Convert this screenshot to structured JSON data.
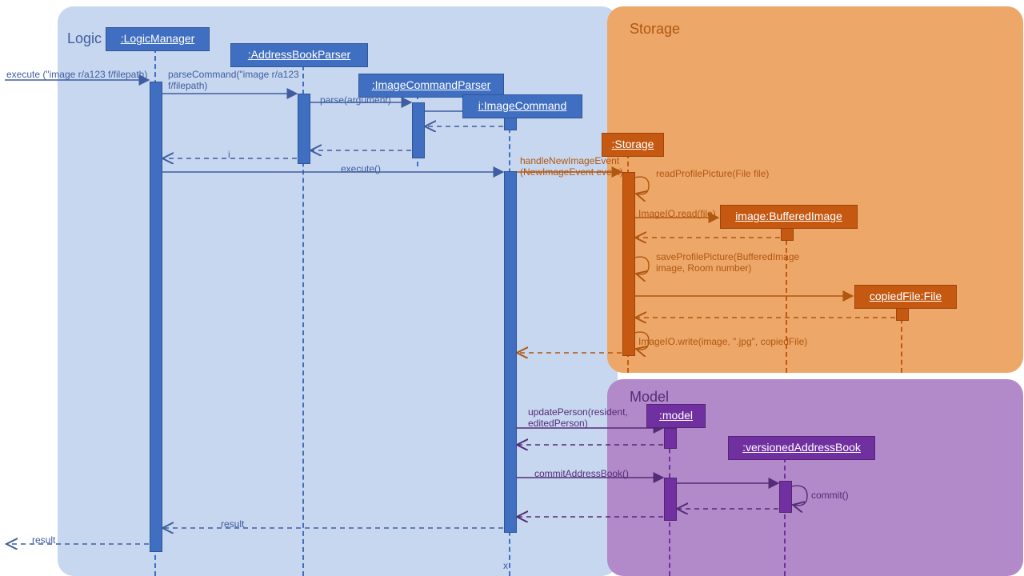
{
  "packages": {
    "logic": {
      "title": "Logic"
    },
    "storage": {
      "title": "Storage"
    },
    "model": {
      "title": "Model"
    }
  },
  "participants": {
    "logicManager": ":LogicManager",
    "parser": ":AddressBookParser",
    "icp": ":ImageCommandParser",
    "icmd": "i:ImageCommand",
    "storageObj": ":Storage",
    "buffered": "image:BufferedImage",
    "copied": "copiedFile:File",
    "modelObj": ":model",
    "vab": ":versionedAddressBook"
  },
  "messages": {
    "entry": "execute (\"image r/a123 f/filepath)",
    "parseCmd": "parseCommand(\"image r/a123 f/filepath)",
    "parseArg": "parse(argument)",
    "i": "i",
    "execute": "execute()",
    "handle": "handleNewImageEvent (NewImageEvent event)",
    "readProfile": "readProfilePicture(File file)",
    "ioRead": "ImageIO.read(file)",
    "saveProfile": "saveProfilePicture(BufferedImage image, Room number)",
    "ioWrite": "ImageIO.write(image, \".jpg\", copiedFile)",
    "updatePerson": "updatePerson(resident, editedPerson)",
    "commitAB": "commitAddressBook()",
    "commit": "commit()",
    "result": "result",
    "x": "x"
  },
  "colors": {
    "blue": "#406fc1",
    "orange": "#c55911",
    "purple": "#7030a0",
    "blueText": "#3f5da0",
    "orangeText": "#b15710",
    "purpleText": "#552b78"
  },
  "chart_data": {
    "type": "sequence-diagram",
    "packages": [
      "Logic",
      "Storage",
      "Model"
    ],
    "lifelines": [
      {
        "name": ":LogicManager",
        "package": "Logic"
      },
      {
        "name": ":AddressBookParser",
        "package": "Logic"
      },
      {
        "name": ":ImageCommandParser",
        "package": "Logic"
      },
      {
        "name": "i:ImageCommand",
        "package": "Logic"
      },
      {
        "name": ":Storage",
        "package": "Storage"
      },
      {
        "name": "image:BufferedImage",
        "package": "Storage"
      },
      {
        "name": "copiedFile:File",
        "package": "Storage"
      },
      {
        "name": ":model",
        "package": "Model"
      },
      {
        "name": ":versionedAddressBook",
        "package": "Model"
      }
    ],
    "messages": [
      {
        "from": "actor",
        "to": ":LogicManager",
        "label": "execute (\"image r/a123 f/filepath)",
        "kind": "call"
      },
      {
        "from": ":LogicManager",
        "to": ":AddressBookParser",
        "label": "parseCommand(\"image r/a123 f/filepath)",
        "kind": "call"
      },
      {
        "from": ":AddressBookParser",
        "to": ":ImageCommandParser",
        "label": "parse(argument)",
        "kind": "call"
      },
      {
        "from": ":ImageCommandParser",
        "to": "i:ImageCommand",
        "label": "",
        "kind": "create"
      },
      {
        "from": "i:ImageCommand",
        "to": ":ImageCommandParser",
        "label": "",
        "kind": "return"
      },
      {
        "from": ":ImageCommandParser",
        "to": ":AddressBookParser",
        "label": "",
        "kind": "return"
      },
      {
        "from": ":AddressBookParser",
        "to": ":LogicManager",
        "label": "i",
        "kind": "return"
      },
      {
        "from": ":LogicManager",
        "to": "i:ImageCommand",
        "label": "execute()",
        "kind": "call"
      },
      {
        "from": "i:ImageCommand",
        "to": ":Storage",
        "label": "handleNewImageEvent (NewImageEvent event)",
        "kind": "call"
      },
      {
        "from": ":Storage",
        "to": ":Storage",
        "label": "readProfilePicture(File file)",
        "kind": "self"
      },
      {
        "from": ":Storage",
        "to": "image:BufferedImage",
        "label": "ImageIO.read(file)",
        "kind": "create"
      },
      {
        "from": "image:BufferedImage",
        "to": ":Storage",
        "label": "",
        "kind": "return"
      },
      {
        "from": ":Storage",
        "to": ":Storage",
        "label": "saveProfilePicture(BufferedImage image, Room number)",
        "kind": "self"
      },
      {
        "from": ":Storage",
        "to": "copiedFile:File",
        "label": "",
        "kind": "create"
      },
      {
        "from": "copiedFile:File",
        "to": ":Storage",
        "label": "",
        "kind": "return"
      },
      {
        "from": ":Storage",
        "to": ":Storage",
        "label": "ImageIO.write(image, \".jpg\", copiedFile)",
        "kind": "self"
      },
      {
        "from": ":Storage",
        "to": "i:ImageCommand",
        "label": "",
        "kind": "return"
      },
      {
        "from": "i:ImageCommand",
        "to": ":model",
        "label": "updatePerson(resident, editedPerson)",
        "kind": "call"
      },
      {
        "from": ":model",
        "to": "i:ImageCommand",
        "label": "",
        "kind": "return"
      },
      {
        "from": "i:ImageCommand",
        "to": ":model",
        "label": "commitAddressBook()",
        "kind": "call"
      },
      {
        "from": ":model",
        "to": ":versionedAddressBook",
        "label": "",
        "kind": "call"
      },
      {
        "from": ":versionedAddressBook",
        "to": ":versionedAddressBook",
        "label": "commit()",
        "kind": "self"
      },
      {
        "from": ":versionedAddressBook",
        "to": ":model",
        "label": "",
        "kind": "return"
      },
      {
        "from": ":model",
        "to": "i:ImageCommand",
        "label": "",
        "kind": "return"
      },
      {
        "from": "i:ImageCommand",
        "to": ":LogicManager",
        "label": "result",
        "kind": "return"
      },
      {
        "from": ":LogicManager",
        "to": "actor",
        "label": "result",
        "kind": "return"
      },
      {
        "from": "i:ImageCommand",
        "to": "destroy",
        "label": "x",
        "kind": "destroy"
      }
    ]
  }
}
